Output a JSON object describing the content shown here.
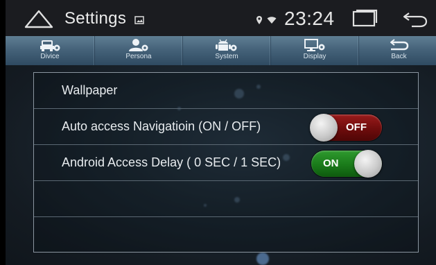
{
  "status_bar": {
    "title": "Settings",
    "time": "23:24",
    "icons": {
      "home": "home-outline-icon",
      "notification": "gallery-icon",
      "location": "location-pin-icon",
      "wifi": "wifi-icon",
      "recents": "recent-apps-icon",
      "back": "back-arrow-icon"
    }
  },
  "tabs": [
    {
      "label": "Divice",
      "icon": "car-gear-icon"
    },
    {
      "label": "Persona",
      "icon": "person-gear-icon"
    },
    {
      "label": "System",
      "icon": "android-gear-icon"
    },
    {
      "label": "Display",
      "icon": "monitor-gear-icon"
    },
    {
      "label": "Back",
      "icon": "back-arrow-icon"
    }
  ],
  "settings": {
    "rows": [
      {
        "label": "Wallpaper"
      },
      {
        "label": "Auto access Navigatioin (ON / OFF)",
        "toggle": {
          "state": "off",
          "text": "OFF"
        }
      },
      {
        "label": "Android Access Delay ( 0 SEC / 1 SEC)",
        "toggle": {
          "state": "on",
          "text": "ON"
        }
      },
      {
        "label": ""
      },
      {
        "label": ""
      }
    ]
  },
  "colors": {
    "status_bar_bg": "#1b1c20",
    "tab_bar": "#46637a",
    "toggle_off": "#8a1414",
    "toggle_on": "#1f8a1f",
    "panel_border": "#8b96a0"
  }
}
